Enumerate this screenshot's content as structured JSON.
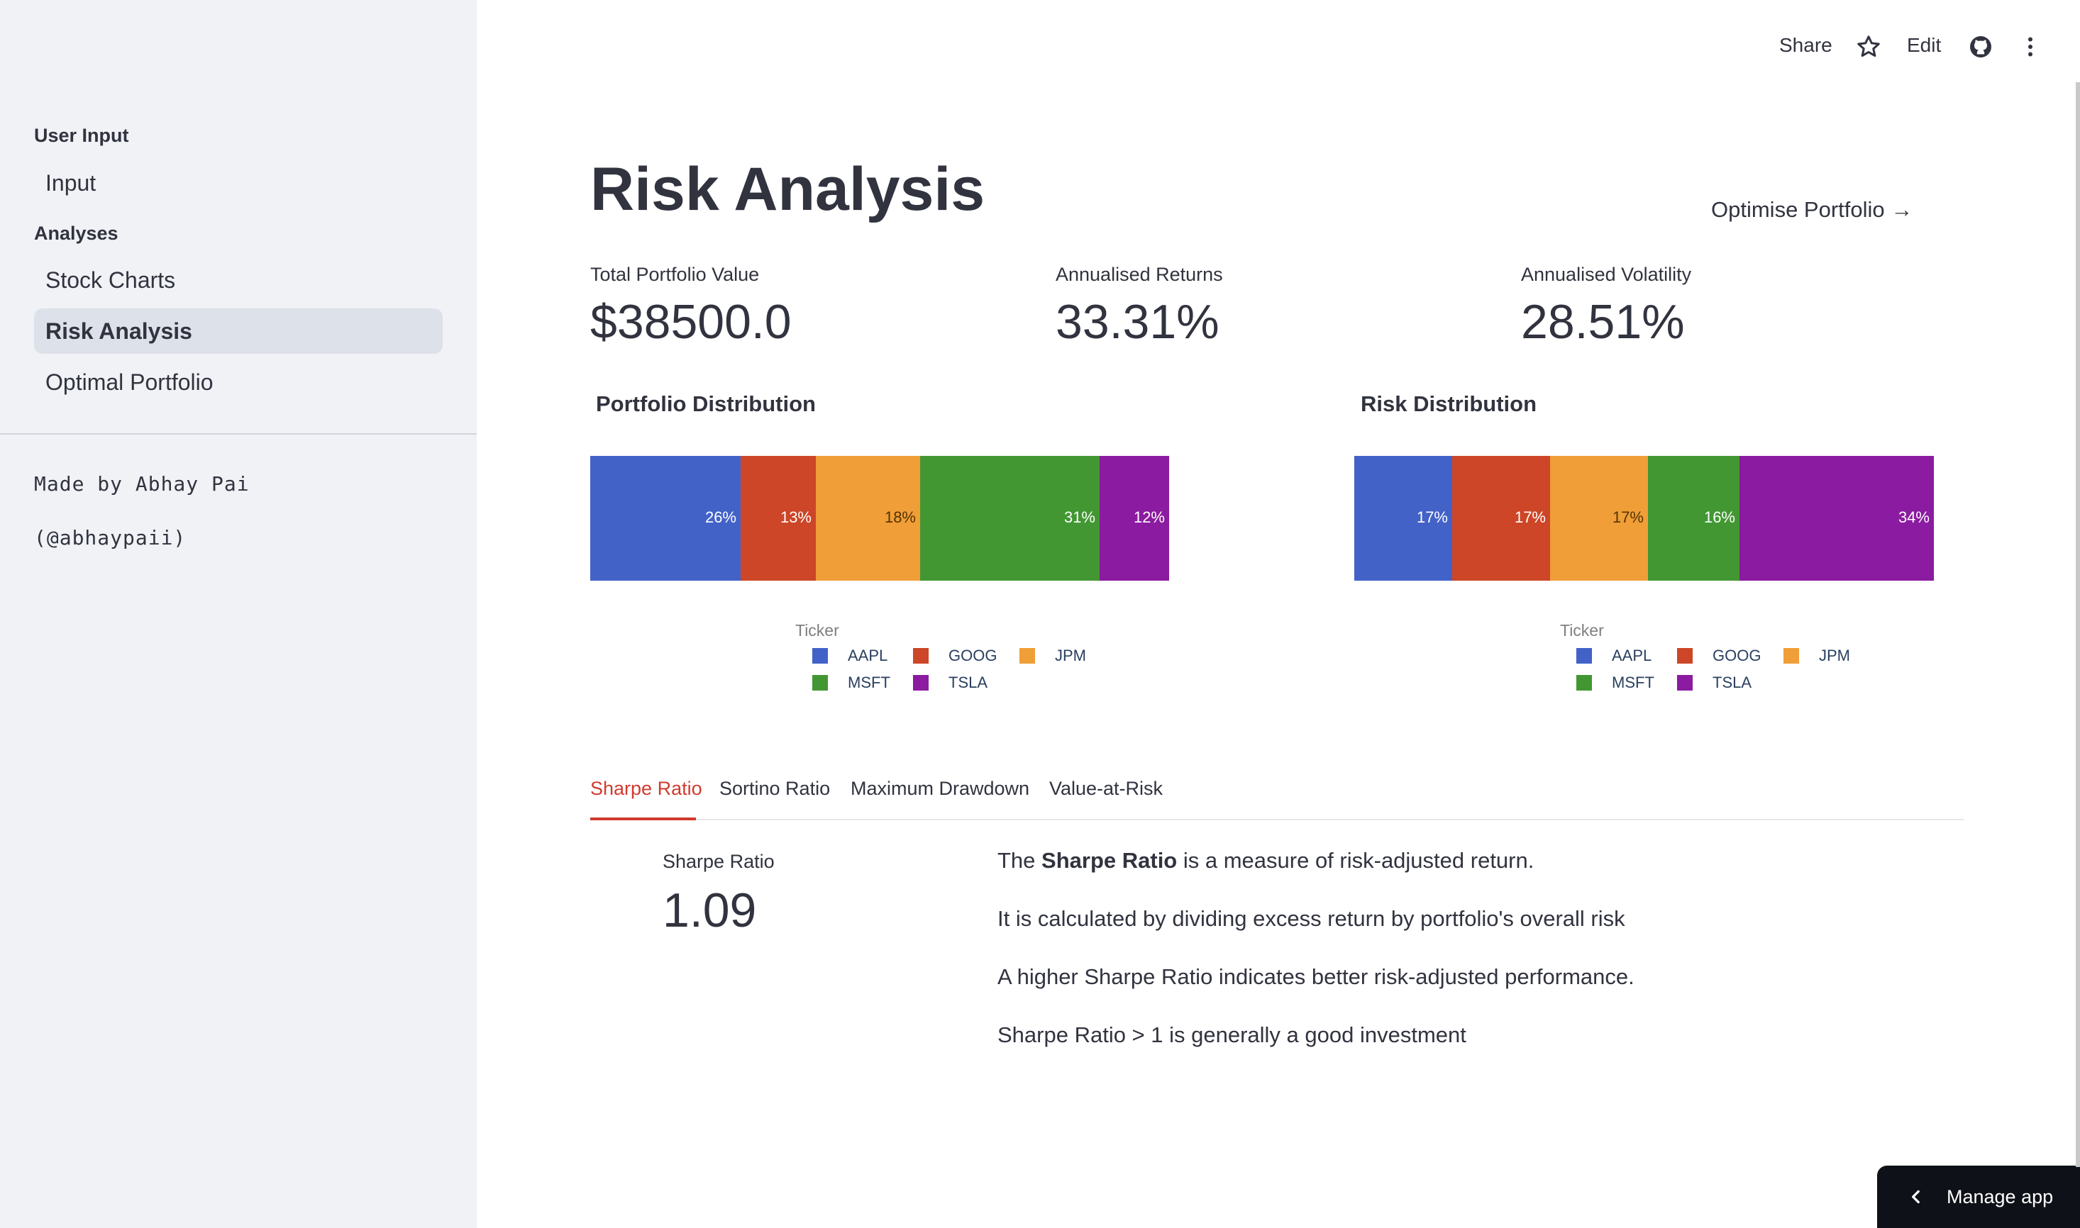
{
  "sidebar": {
    "sections": [
      {
        "title": "User Input",
        "items": [
          "Input"
        ]
      },
      {
        "title": "Analyses",
        "items": [
          "Stock Charts",
          "Risk Analysis",
          "Optimal Portfolio"
        ]
      }
    ],
    "active_item": "Risk Analysis",
    "footer": [
      "Made by Abhay Pai",
      "(@abhaypaii)"
    ]
  },
  "toolbar": {
    "share": "Share",
    "star_icon": "star-icon",
    "edit": "Edit",
    "github_icon": "github-icon",
    "menu_icon": "kebab-menu-icon"
  },
  "main": {
    "title": "Risk Analysis",
    "optimise_link": "Optimise Portfolio →",
    "metrics": [
      {
        "label": "Total Portfolio Value",
        "value": "$38500.0"
      },
      {
        "label": "Annualised Returns",
        "value": "33.31%"
      },
      {
        "label": "Annualised Volatility",
        "value": "28.51%"
      }
    ]
  },
  "colors": {
    "AAPL": "#4262c8",
    "GOOG": "#cc4627",
    "JPM": "#f09e38",
    "MSFT": "#429732",
    "TSLA": "#8b1ba0",
    "accent": "#d03b2f"
  },
  "chart_data": [
    {
      "type": "bar",
      "orientation": "horizontal-stacked",
      "title": "Portfolio Distribution",
      "legend_title": "Ticker",
      "series": [
        {
          "name": "AAPL",
          "values": [
            26
          ],
          "label": "26%"
        },
        {
          "name": "GOOG",
          "values": [
            13
          ],
          "label": "13%"
        },
        {
          "name": "JPM",
          "values": [
            18
          ],
          "label": "18%"
        },
        {
          "name": "MSFT",
          "values": [
            31
          ],
          "label": "31%"
        },
        {
          "name": "TSLA",
          "values": [
            12
          ],
          "label": "12%"
        }
      ]
    },
    {
      "type": "bar",
      "orientation": "horizontal-stacked",
      "title": "Risk Distribution",
      "legend_title": "Ticker",
      "series": [
        {
          "name": "AAPL",
          "values": [
            17
          ],
          "label": "17%"
        },
        {
          "name": "GOOG",
          "values": [
            17
          ],
          "label": "17%"
        },
        {
          "name": "JPM",
          "values": [
            17
          ],
          "label": "17%"
        },
        {
          "name": "MSFT",
          "values": [
            16
          ],
          "label": "16%"
        },
        {
          "name": "TSLA",
          "values": [
            34
          ],
          "label": "34%"
        }
      ]
    }
  ],
  "tabs": {
    "items": [
      "Sharpe Ratio",
      "Sortino Ratio",
      "Maximum Drawdown",
      "Value-at-Risk"
    ],
    "active": "Sharpe Ratio"
  },
  "sharpe": {
    "metric_label": "Sharpe Ratio",
    "metric_value": "1.09",
    "desc_prefix": "The ",
    "desc_bold": "Sharpe Ratio",
    "desc_suffix": " is a measure of risk-adjusted return.",
    "lines": [
      "It is calculated by dividing excess return by portfolio's overall risk",
      "A higher Sharpe Ratio indicates better risk-adjusted performance.",
      "Sharpe Ratio > 1 is generally a good investment"
    ]
  },
  "manage_app": "Manage app"
}
